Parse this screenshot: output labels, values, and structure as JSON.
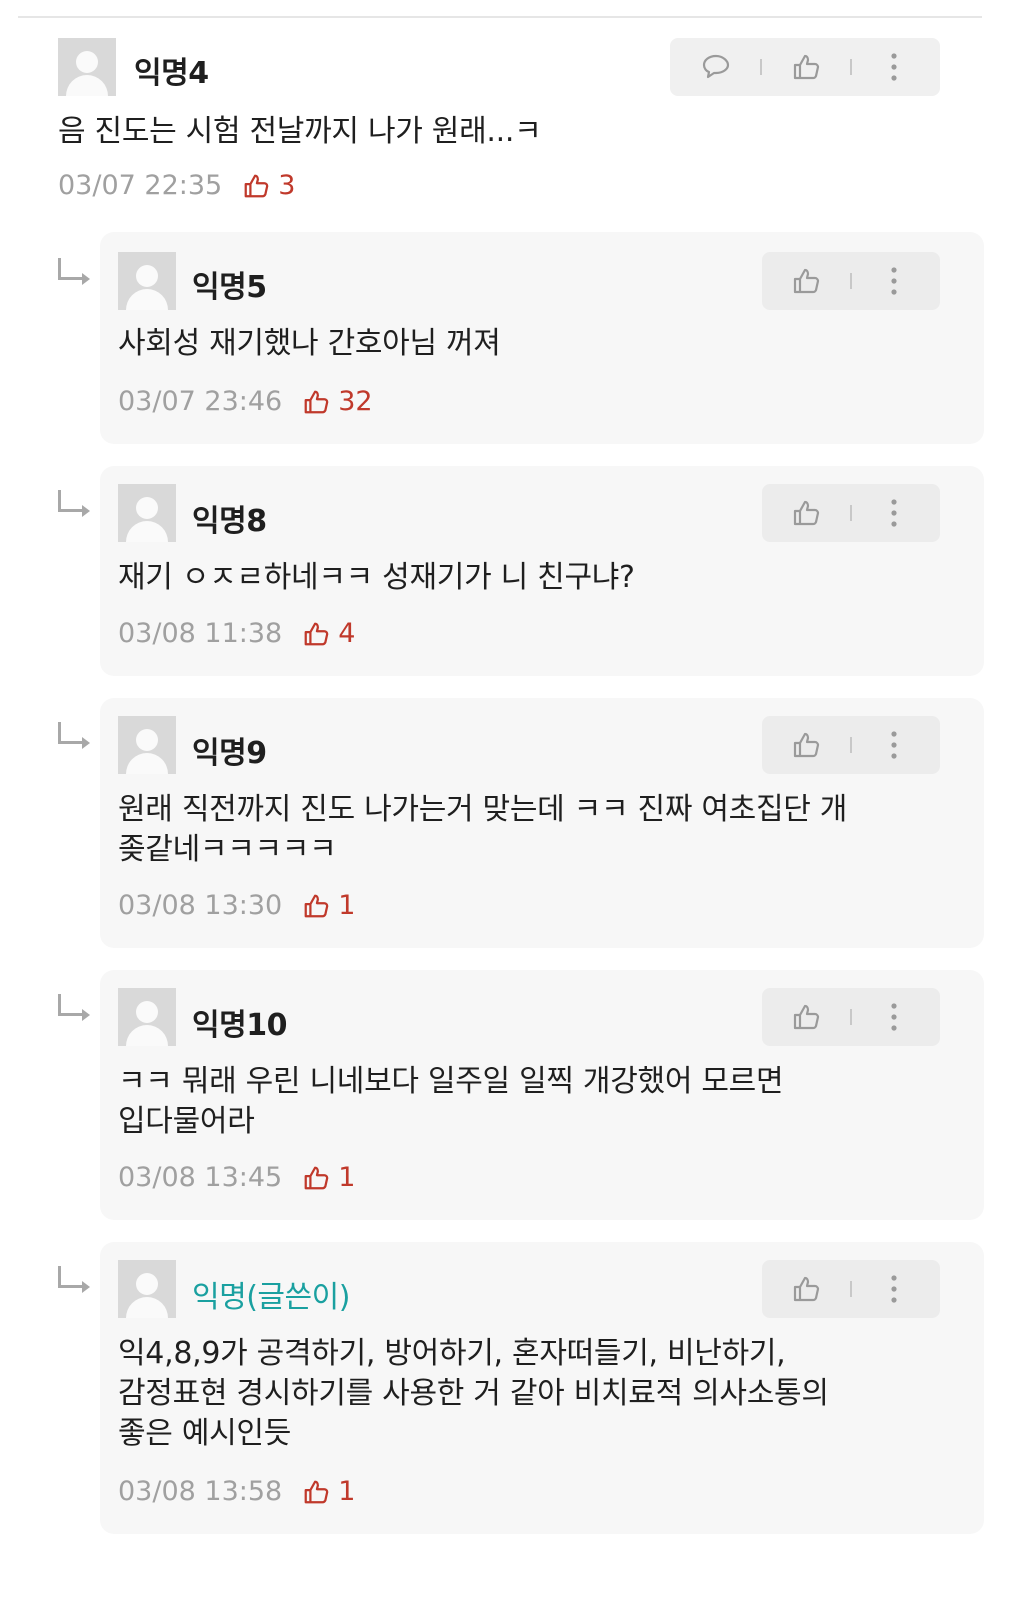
{
  "comments": [
    {
      "author": "익명4",
      "text": "음 진도는 시험 전날까지 나가 원래...ㅋ",
      "time": "03/07 22:35",
      "likes": "3"
    },
    {
      "author": "익명5",
      "text": "사회성 재기했나 간호아님 꺼져",
      "time": "03/07 23:46",
      "likes": "32"
    },
    {
      "author": "익명8",
      "text": "재기 ㅇㅈㄹ하네ㅋㅋ 성재기가 니 친구냐?",
      "time": "03/08 11:38",
      "likes": "4"
    },
    {
      "author": "익명9",
      "text_lines": [
        "원래 직전까지 진도 나가는거 맞는데 ㅋㅋ 진짜 여초집단 개",
        "좆같네ㅋㅋㅋㅋㅋ"
      ],
      "time": "03/08 13:30",
      "likes": "1"
    },
    {
      "author": "익명10",
      "text_lines": [
        "ㅋㅋ 뭐래 우린 니네보다 일주일 일찍 개강했어 모르면",
        "입다물어라"
      ],
      "time": "03/08 13:45",
      "likes": "1"
    },
    {
      "author": "익명(글쓴이)",
      "text_lines": [
        "익4,8,9가 공격하기, 방어하기, 혼자떠들기, 비난하기,",
        "감정표현 경시하기를 사용한 거 같아 비치료적 의사소통의",
        "좋은 예시인듯"
      ],
      "time": "03/08 13:58",
      "likes": "1"
    }
  ],
  "colors": {
    "op_author": "#1aa0a0",
    "like": "#c0392b",
    "meta": "#a0a0a0"
  },
  "icons": {
    "reply": "speech-bubble-icon",
    "like": "thumbs-up-icon",
    "more": "vertical-dots-icon"
  }
}
